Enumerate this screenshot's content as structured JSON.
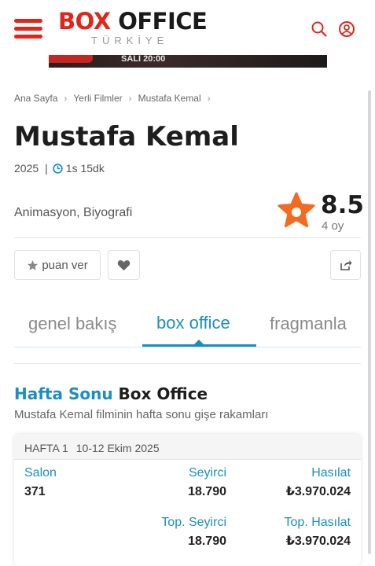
{
  "header": {
    "logo_box": "B",
    "logo_box_o": "O",
    "logo_box_x": "X",
    "logo_office": "OFFICE",
    "logo_sub": "TÜRKİYE",
    "banner_text": "SALI 20:00"
  },
  "breadcrumb": {
    "items": [
      "Ana Sayfa",
      "Yerli Filmler",
      "Mustafa Kemal"
    ]
  },
  "movie": {
    "title": "Mustafa Kemal",
    "year": "2025",
    "duration": "1s 15dk",
    "genres": "Animasyon, Biyografi",
    "rating": "8.5",
    "votes": "4 oy"
  },
  "actions": {
    "rate_label": "puan ver"
  },
  "tabs": [
    {
      "label": "genel bakış"
    },
    {
      "label": "box office"
    },
    {
      "label": "fragmanla"
    }
  ],
  "section": {
    "title_blue": "Hafta Sonu",
    "title_dark": "Box Office",
    "subtitle": "Mustafa Kemal filminin hafta sonu gişe rakamları"
  },
  "week_card": {
    "week": "HAFTA 1",
    "dates": "10-12 Ekim 2025",
    "salon_label": "Salon",
    "salon_value": "371",
    "seyirci_label": "Seyirci",
    "seyirci_value": "18.790",
    "hasilat_label": "Hasılat",
    "hasilat_value": "₺3.970.024",
    "top_seyirci_label": "Top. Seyirci",
    "top_seyirci_value": "18.790",
    "top_hasilat_label": "Top. Hasılat",
    "top_hasilat_value": "₺3.970.024"
  },
  "colors": {
    "brand_red": "#e1251b",
    "accent_blue": "#1a8fbf",
    "star_orange": "#f26b21"
  },
  "icons": [
    "hamburger-icon",
    "search-icon",
    "user-icon",
    "chevron-right-icon",
    "clock-icon",
    "star-icon",
    "heart-icon",
    "share-icon"
  ]
}
